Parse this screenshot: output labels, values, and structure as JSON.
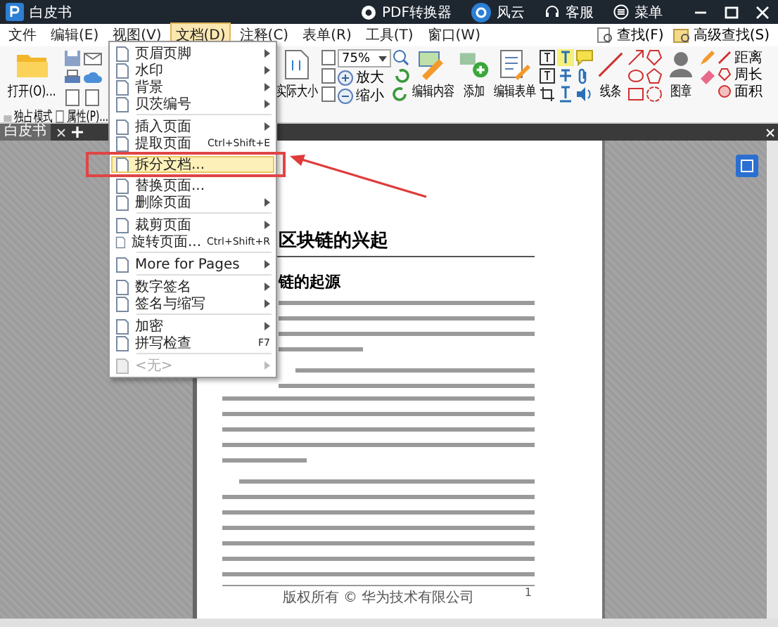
{
  "title_bar": {
    "app_name": "白皮书",
    "converter": "PDF转换器",
    "user": "风云",
    "support": "客服",
    "menu": "菜单"
  },
  "menu_bar": [
    {
      "label": "文件",
      "selected": false
    },
    {
      "label": "编辑(E)",
      "selected": false
    },
    {
      "label": "视图(V)",
      "selected": false
    },
    {
      "label": "文档(D)",
      "selected": true
    },
    {
      "label": "注释(C)",
      "selected": false
    },
    {
      "label": "表单(R)",
      "selected": false
    },
    {
      "label": "工具(T)",
      "selected": false
    },
    {
      "label": "窗口(W)",
      "selected": false
    }
  ],
  "find_links": [
    "查找(F)",
    "高级查找(S)"
  ],
  "ribbon": {
    "open": "打开(O)...",
    "exclusive_mode": "独占模式",
    "properties": "属性(P)...",
    "actual_size": "实际大小",
    "zoom": "75%",
    "zoom_in": "放大",
    "zoom_out": "缩小",
    "edit_content": "编辑内容",
    "add": "添加",
    "edit_form": "编辑表单",
    "line": "线条",
    "stamp": "图章",
    "distance": "距离",
    "perimeter": "周长",
    "area": "面积"
  },
  "tabs": [
    {
      "label": "白皮书",
      "selected": true
    }
  ],
  "document_menu": [
    {
      "kind": "item",
      "label": "页眉页脚",
      "submenu": true,
      "selected": false,
      "disabled": false
    },
    {
      "kind": "item",
      "label": "水印",
      "submenu": true,
      "selected": false,
      "disabled": false
    },
    {
      "kind": "item",
      "label": "背景",
      "submenu": true,
      "selected": false,
      "disabled": false
    },
    {
      "kind": "item",
      "label": "贝茨编号",
      "submenu": true,
      "selected": false,
      "disabled": false
    },
    {
      "kind": "separator"
    },
    {
      "kind": "item",
      "label": "插入页面",
      "submenu": true,
      "selected": false,
      "disabled": false
    },
    {
      "kind": "item",
      "label": "提取页面",
      "shortcut": "Ctrl+Shift+E",
      "submenu": false,
      "selected": false,
      "disabled": false
    },
    {
      "kind": "item",
      "label": "拆分文档...",
      "submenu": false,
      "selected": true,
      "disabled": false
    },
    {
      "kind": "item",
      "label": "替换页面...",
      "submenu": false,
      "selected": false,
      "disabled": false
    },
    {
      "kind": "item",
      "label": "删除页面",
      "submenu": true,
      "selected": false,
      "disabled": false
    },
    {
      "kind": "separator"
    },
    {
      "kind": "item",
      "label": "裁剪页面",
      "submenu": true,
      "selected": false,
      "disabled": false
    },
    {
      "kind": "item",
      "label": "旋转页面...",
      "shortcut": "Ctrl+Shift+R",
      "submenu": false,
      "selected": false,
      "disabled": false
    },
    {
      "kind": "separator"
    },
    {
      "kind": "item",
      "label": "More for Pages",
      "submenu": true,
      "selected": false,
      "disabled": false
    },
    {
      "kind": "separator"
    },
    {
      "kind": "item",
      "label": "数字签名",
      "submenu": true,
      "selected": false,
      "disabled": false
    },
    {
      "kind": "item",
      "label": "签名与缩写",
      "submenu": true,
      "selected": false,
      "disabled": false
    },
    {
      "kind": "separator"
    },
    {
      "kind": "item",
      "label": "加密",
      "submenu": true,
      "selected": false,
      "disabled": false
    },
    {
      "kind": "item",
      "label": "拼写检查",
      "shortcut": "F7",
      "submenu": false,
      "selected": false,
      "disabled": false
    },
    {
      "kind": "separator"
    },
    {
      "kind": "item",
      "label": "<无>",
      "submenu": true,
      "selected": false,
      "disabled": true
    }
  ],
  "document": {
    "heading": "区块链的兴起",
    "subheading": "链的起源",
    "footer": "版权所有 © 华为技术有限公司",
    "page_number": "1"
  }
}
